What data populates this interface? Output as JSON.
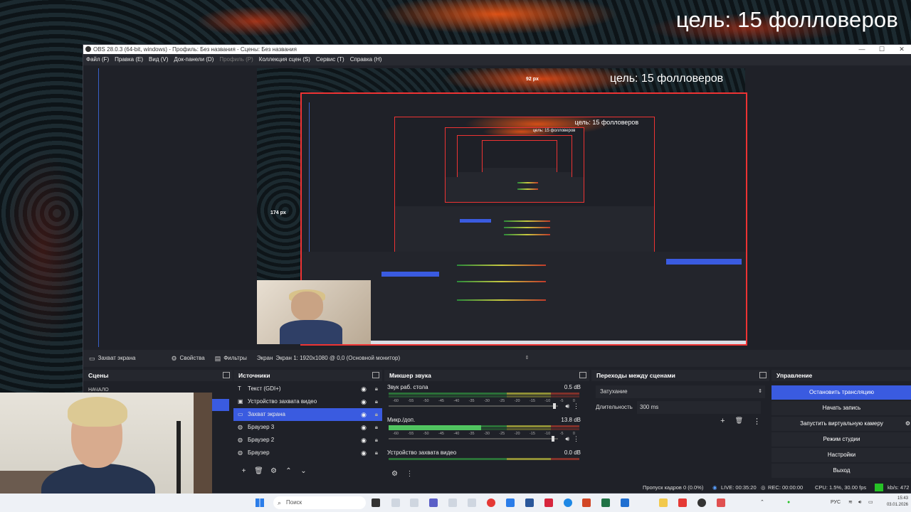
{
  "overlay": {
    "goal_text": "цель: 15 фолловеров"
  },
  "window": {
    "title": "OBS 28.0.3 (64-bit, windows) - Профиль: Без названия - Сцены: Без названия",
    "min": "—",
    "max": "☐",
    "close": "✕"
  },
  "menu": [
    "Файл (F)",
    "Правка (E)",
    "Вид (V)",
    "Док-панели (D)",
    "Профиль (P)",
    "Коллекция сцен (S)",
    "Сервис (T)",
    "Справка (H)"
  ],
  "preview": {
    "goal_text": "цель: 15 фолловеров",
    "label_top": "92 px",
    "label_left": "174 px"
  },
  "source_toolbar": {
    "source_name": "Захват экрана",
    "properties": "Свойства",
    "filters": "Фильтры",
    "screen_label": "Экран",
    "screen_value": "Экран 1: 1920x1080 @ 0,0 (Основной монитор)"
  },
  "scenes": {
    "title": "Сцены",
    "items": [
      "НАЧАЛО"
    ]
  },
  "sources": {
    "title": "Источники",
    "items": [
      {
        "name": "Текст (GDI+)",
        "icon": "text-icon",
        "selected": false
      },
      {
        "name": "Устройство захвата видео",
        "icon": "camera-icon",
        "selected": false
      },
      {
        "name": "Захват экрана",
        "icon": "monitor-icon",
        "selected": true
      },
      {
        "name": "Браузер 3",
        "icon": "globe-icon",
        "selected": false
      },
      {
        "name": "Браузер 2",
        "icon": "globe-icon",
        "selected": false
      },
      {
        "name": "Браузер",
        "icon": "globe-icon",
        "selected": false
      }
    ]
  },
  "mixer": {
    "title": "Микшер звука",
    "channels": [
      {
        "name": "Звук раб. стола",
        "db": "0.5 dB",
        "level": 0.0,
        "volume": 0.98
      },
      {
        "name": "Микр./доп.",
        "db": "13.8 dB",
        "level": 0.5,
        "volume": 0.97
      },
      {
        "name": "Устройство захвата видео",
        "db": "0.0 dB",
        "level": 0.0,
        "volume": 0.97
      }
    ],
    "scale": [
      "-60",
      "-55",
      "-50",
      "-45",
      "-40",
      "-35",
      "-30",
      "-25",
      "-20",
      "-15",
      "-10",
      "-5",
      "0"
    ]
  },
  "transitions": {
    "title": "Переходы между сценами",
    "type": "Затухание",
    "duration_label": "Длительность",
    "duration_value": "300 ms"
  },
  "controls": {
    "title": "Управление",
    "buttons": [
      "Остановить трансляцию",
      "Начать запись",
      "Запустить виртуальную камеру",
      "Режим студии",
      "Настройки",
      "Выход"
    ]
  },
  "status": {
    "dropped": "Пропуск кадров 0 (0.0%)",
    "live": "LIVE: 00:35:20",
    "rec": "REC: 00:00:00",
    "cpu": "CPU: 1.5%, 30.00 fps",
    "kbs": "kb/s: 472"
  },
  "taskbar": {
    "search_placeholder": "Поиск",
    "lang": "РУС",
    "time": "15:43",
    "date": "03.01.2026"
  },
  "colors": {
    "accent": "#3a5be0",
    "selection_border": "#e33333",
    "live_indicator": "#26c226"
  }
}
